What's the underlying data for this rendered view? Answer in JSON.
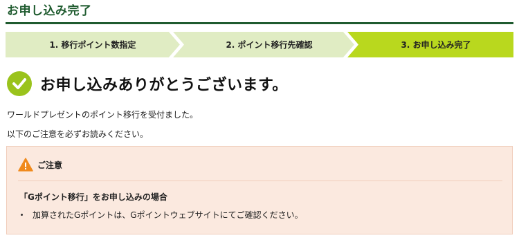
{
  "page": {
    "title": "お申し込み完了"
  },
  "steps": [
    {
      "label": "1. 移行ポイント数指定",
      "state": "done"
    },
    {
      "label": "2. ポイント移行先確認",
      "state": "done"
    },
    {
      "label": "3. お申し込み完了",
      "state": "current"
    }
  ],
  "completion": {
    "icon": "check-circle-icon",
    "heading": "お申し込みありがとうございます。"
  },
  "messages": [
    "ワールドプレゼントのポイント移行を受付ました。",
    "以下のご注意を必ずお読みください。"
  ],
  "notice": {
    "icon": "warning-icon",
    "title": "ご注意",
    "subheading": "「Gポイント移行」をお申し込みの場合",
    "items": [
      "加算されたGポイントは、Gポイントウェブサイトにてご確認ください。"
    ]
  },
  "colors": {
    "title": "#1f5b2f",
    "step_inactive": "#e0ecc3",
    "step_active": "#b9d81e",
    "check": "#9ac31c",
    "notice_bg": "#fbe9df",
    "warning": "#f08a1c"
  }
}
